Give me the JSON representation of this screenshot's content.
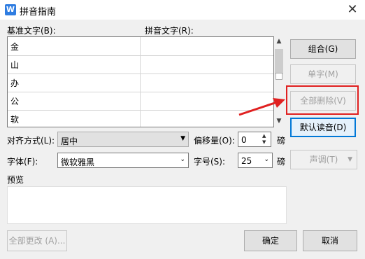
{
  "window": {
    "title": "拼音指南",
    "app_icon": "W",
    "close_glyph": "✕"
  },
  "labels": {
    "base_text": "基准文字(B):",
    "ruby_text": "拼音文字(R):",
    "align": "对齐方式(L):",
    "offset": "偏移量(O):",
    "offset_unit": "磅",
    "font": "字体(F):",
    "size": "字号(S):",
    "size_unit": "磅",
    "preview": "预览"
  },
  "grid": {
    "rows": [
      {
        "base": "金",
        "ruby": ""
      },
      {
        "base": "山",
        "ruby": ""
      },
      {
        "base": "办",
        "ruby": ""
      },
      {
        "base": "公",
        "ruby": ""
      },
      {
        "base": "软",
        "ruby": ""
      }
    ]
  },
  "scrollbar": {
    "up": "▲",
    "down": "▼"
  },
  "buttons": {
    "group": "组合(G)",
    "single_char": "单字(M)",
    "clear_all": "全部删除(V)",
    "default_reading": "默认读音(D)",
    "tone": "声调(T)",
    "apply_all": "全部更改 (A)...",
    "ok": "确定",
    "cancel": "取消"
  },
  "fields": {
    "align_value": "居中",
    "offset_value": "0",
    "font_value": "微软雅黑",
    "size_value": "25"
  },
  "arrows": {
    "dropdown": "▼",
    "chevron": "⌄",
    "spin_up": "▲",
    "spin_down": "▼"
  },
  "colors": {
    "highlight": "#e02020",
    "accent": "#0078d7",
    "app_icon_bg": "#2f7de1"
  }
}
